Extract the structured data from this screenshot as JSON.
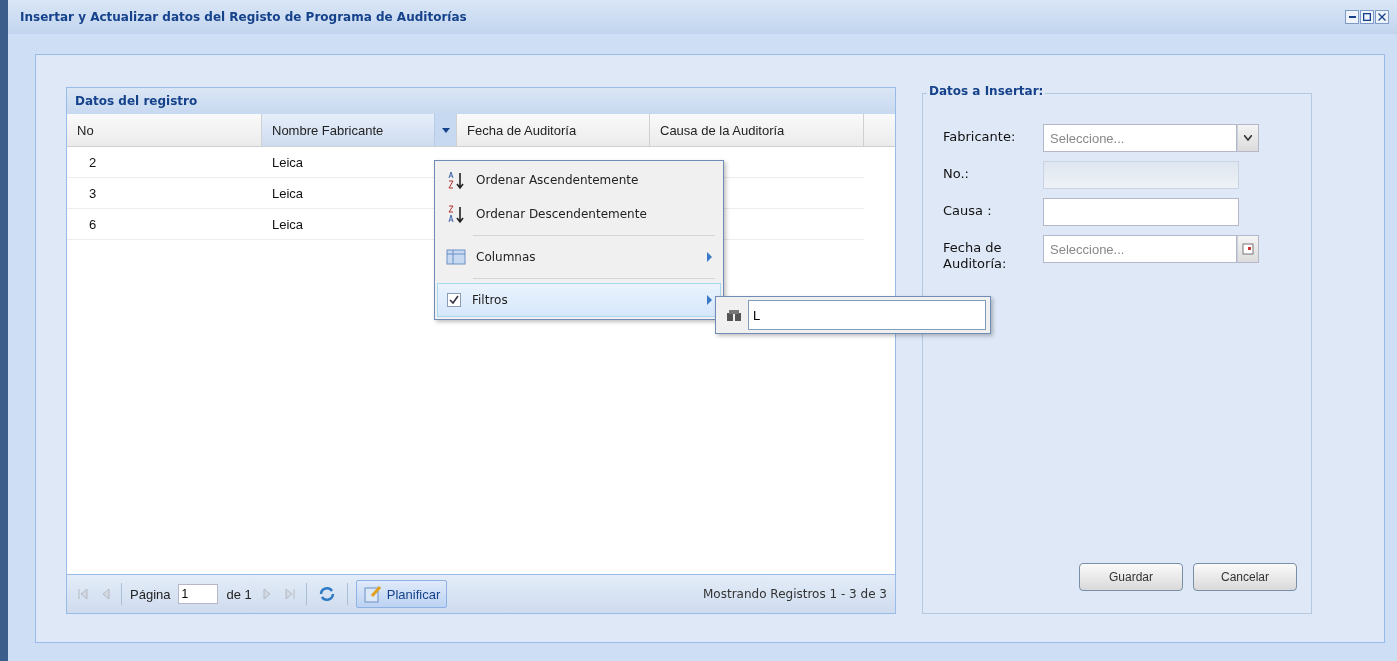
{
  "window": {
    "title": "Insertar y Actualizar datos del Registo de Programa de Auditorías"
  },
  "grid": {
    "title": "Datos del registro",
    "columns": [
      {
        "label": "No",
        "menu_open": false
      },
      {
        "label": "Nombre Fabricante",
        "menu_open": true
      },
      {
        "label": "Fecha de Auditoría",
        "menu_open": false
      },
      {
        "label": "Causa de la Auditoría",
        "menu_open": false
      }
    ],
    "rows": [
      [
        "2",
        "Leica"
      ],
      [
        "3",
        "Leica"
      ],
      [
        "6",
        "Leica"
      ]
    ],
    "column_menu": {
      "items": [
        {
          "kind": "sort-asc",
          "label": "Ordenar Ascendentemente",
          "selected": false
        },
        {
          "kind": "sort-desc",
          "label": "Ordenar Descendentemente",
          "selected": false
        },
        {
          "kind": "columns",
          "label": "Columnas",
          "selected": false
        },
        {
          "kind": "filters",
          "label": "Filtros",
          "selected": true,
          "checked": true
        }
      ],
      "filter_value": "L"
    },
    "pager": {
      "page_label": "Página",
      "page": "1",
      "of": "de 1",
      "plan_button": "Planificar",
      "summary": "Mostrando Registros 1 - 3 de 3"
    }
  },
  "form": {
    "legend": "Datos a Insertar:",
    "fields": [
      {
        "kind": "combo",
        "label": "Fabricante:",
        "placeholder": "Seleccione..."
      },
      {
        "kind": "text",
        "label": "No.:",
        "disabled": true
      },
      {
        "kind": "text",
        "label": "Causa :",
        "disabled": false
      },
      {
        "kind": "date",
        "label": "Fecha de Auditoría:",
        "placeholder": "Seleccione..."
      }
    ],
    "buttons": [
      "Guardar",
      "Cancelar"
    ]
  }
}
